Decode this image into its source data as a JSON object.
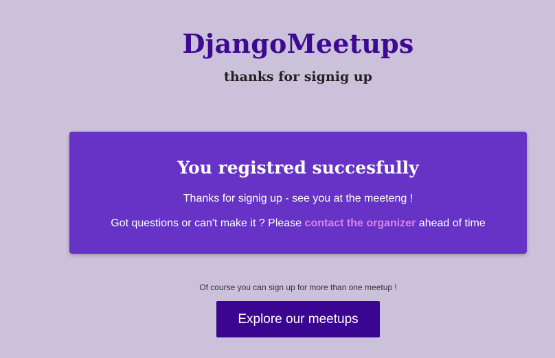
{
  "header": {
    "brand": "DjangoMeetups",
    "subtitle": "thanks for signig up"
  },
  "card": {
    "heading": "You registred succesfully",
    "line1": "Thanks for signig up - see you at the meeteng !",
    "line2_before": "Got questions or can't make it ? Please ",
    "link_text": "contact the organizer",
    "line2_after": " ahead of time"
  },
  "footer": {
    "note": "Of course you can sign up for more than one meetup !",
    "cta_label": "Explore our meetups"
  },
  "colors": {
    "background": "#cbc1da",
    "brand": "#3d0a91",
    "card": "#6633c6",
    "link": "#d985e6",
    "button": "#3a0590"
  }
}
